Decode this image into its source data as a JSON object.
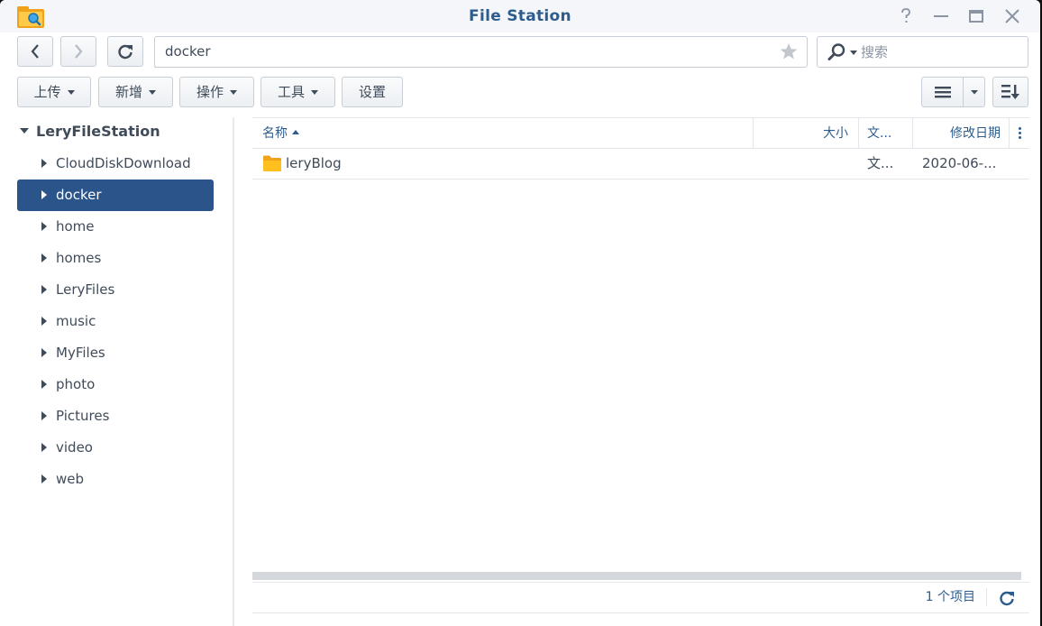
{
  "window": {
    "title": "File Station"
  },
  "icons": {
    "app": "file-station-icon",
    "help": "help-icon",
    "minimize": "minimize-icon",
    "maximize": "maximize-icon",
    "close": "close-icon",
    "back": "chevron-left-icon",
    "forward": "chevron-right-icon",
    "refresh": "refresh-icon",
    "favorite": "star-icon",
    "search": "search-icon",
    "list_view": "list-view-icon",
    "sort": "sort-icon",
    "folder": "folder-icon"
  },
  "colors": {
    "accent": "#2a548a",
    "title": "#2d5c8e",
    "folder": "#f7b500"
  },
  "path": {
    "value": "docker"
  },
  "search": {
    "placeholder": "搜索"
  },
  "toolbar": {
    "upload": "上传",
    "create": "新增",
    "action": "操作",
    "tools": "工具",
    "settings": "设置"
  },
  "sidebar": {
    "root": "LeryFileStation",
    "items": [
      {
        "label": "CloudDiskDownload"
      },
      {
        "label": "docker"
      },
      {
        "label": "home"
      },
      {
        "label": "homes"
      },
      {
        "label": "LeryFiles"
      },
      {
        "label": "music"
      },
      {
        "label": "MyFiles"
      },
      {
        "label": "photo"
      },
      {
        "label": "Pictures"
      },
      {
        "label": "video"
      },
      {
        "label": "web"
      }
    ],
    "selected": "docker"
  },
  "list": {
    "columns": {
      "name": "名称",
      "size": "大小",
      "type": "文...",
      "modified": "修改日期"
    },
    "rows": [
      {
        "name": "leryBlog",
        "size": "",
        "type": "文...",
        "modified": "2020-06-..."
      }
    ]
  },
  "footer": {
    "count": "1 个项目"
  }
}
